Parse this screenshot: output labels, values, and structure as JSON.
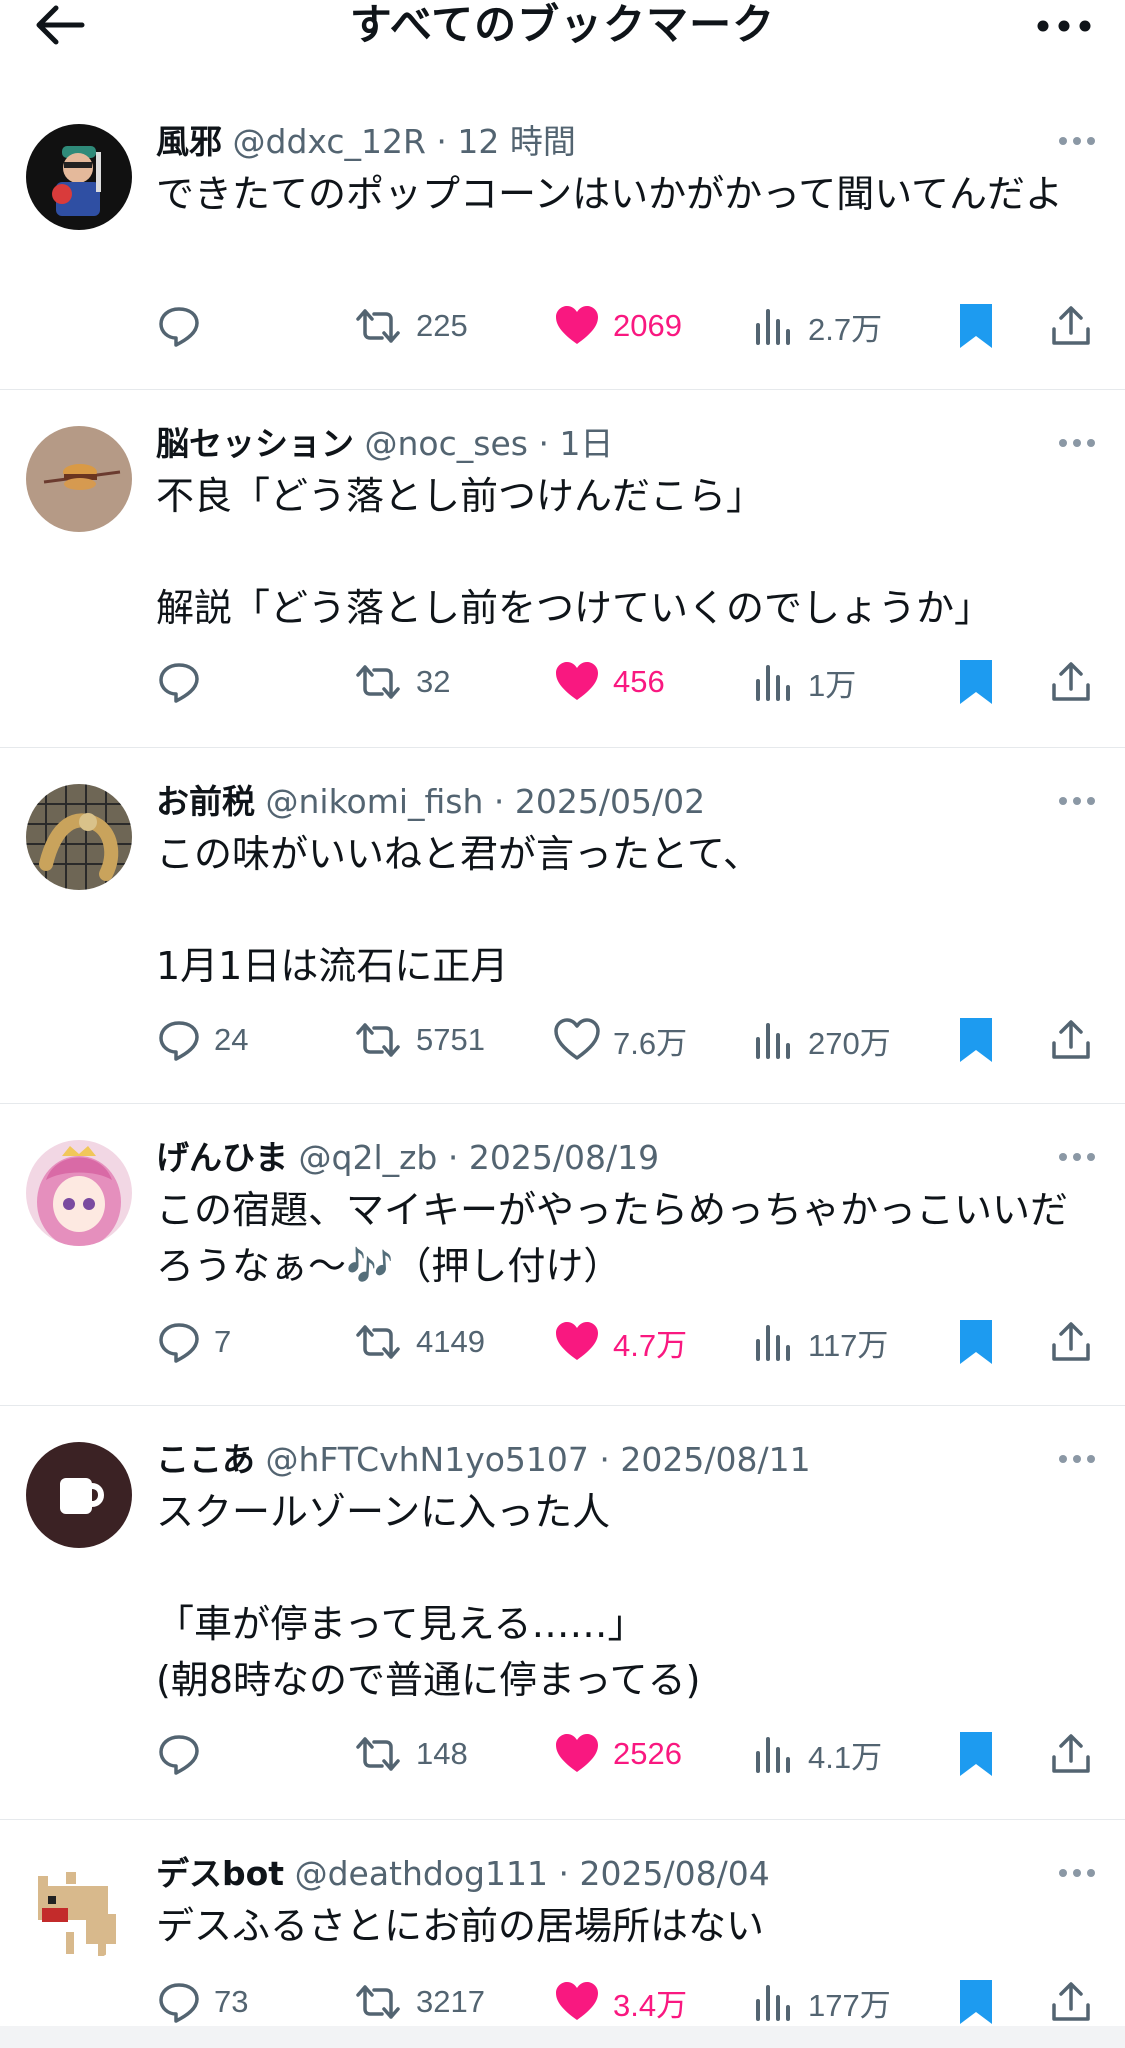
{
  "header": {
    "title": "すべてのブックマーク",
    "back_icon": "arrow-left-icon",
    "more_icon": "ellipsis-icon"
  },
  "colors": {
    "like": "#f91880",
    "bookmark": "#1d9bf0",
    "muted": "#536471",
    "text": "#0f1419"
  },
  "tweets": [
    {
      "name": "風邪",
      "handle": "@ddxc_12R",
      "time": "12 時間",
      "text": "できたてのポップコーンはいかがかって聞いてんだよ",
      "replies": "",
      "retweets": "225",
      "likes": "2069",
      "liked": true,
      "views": "2.7万"
    },
    {
      "name": "脳セッション",
      "handle": "@noc_ses",
      "time": "1日",
      "text": "不良「どう落とし前つけんだこら」\n\n解説「どう落とし前をつけていくのでしょうか」",
      "replies": "",
      "retweets": "32",
      "likes": "456",
      "liked": true,
      "views": "1万"
    },
    {
      "name": "お前税",
      "handle": "@nikomi_fish",
      "time": "2025/05/02",
      "text": "この味がいいねと君が言ったとて、\n\n1月1日は流石に正月",
      "replies": "24",
      "retweets": "5751",
      "likes": "7.6万",
      "liked": false,
      "views": "270万"
    },
    {
      "name": "げんひま",
      "handle": "@q2l_zb",
      "time": "2025/08/19",
      "text": "この宿題、マイキーがやったらめっちゃかっこいいだろうなぁ〜🎶（押し付け）",
      "replies": "7",
      "retweets": "4149",
      "likes": "4.7万",
      "liked": true,
      "views": "117万"
    },
    {
      "name": "ここあ",
      "handle": "@hFTCvhN1yo5107",
      "time": "2025/08/11",
      "text": "スクールゾーンに入った人\n\n「車が停まって見える……」\n(朝8時なので普通に停まってる)",
      "replies": "",
      "retweets": "148",
      "likes": "2526",
      "liked": true,
      "views": "4.1万"
    },
    {
      "name": "デスbot",
      "handle": "@deathdog111",
      "time": "2025/08/04",
      "text": "デスふるさとにお前の居場所はない",
      "replies": "73",
      "retweets": "3217",
      "likes": "3.4万",
      "liked": true,
      "views": "177万"
    }
  ]
}
